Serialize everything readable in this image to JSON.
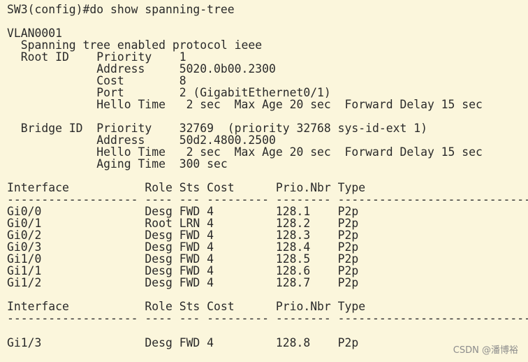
{
  "terminal": {
    "lines": [
      "SW3(config)#do show spanning-tree",
      "",
      "VLAN0001",
      "  Spanning tree enabled protocol ieee",
      "  Root ID    Priority    1",
      "             Address     5020.0b00.2300",
      "             Cost        8",
      "             Port        2 (GigabitEthernet0/1)",
      "             Hello Time   2 sec  Max Age 20 sec  Forward Delay 15 sec",
      "",
      "  Bridge ID  Priority    32769  (priority 32768 sys-id-ext 1)",
      "             Address     50d2.4800.2500",
      "             Hello Time   2 sec  Max Age 20 sec  Forward Delay 15 sec",
      "             Aging Time  300 sec",
      "",
      "Interface           Role Sts Cost      Prio.Nbr Type",
      "------------------- ---- --- --------- -------- --------------------------------",
      "Gi0/0               Desg FWD 4         128.1    P2p",
      "Gi0/1               Root LRN 4         128.2    P2p",
      "Gi0/2               Desg FWD 4         128.3    P2p",
      "Gi0/3               Desg FWD 4         128.4    P2p",
      "Gi1/0               Desg FWD 4         128.5    P2p",
      "Gi1/1               Desg FWD 4         128.6    P2p",
      "Gi1/2               Desg FWD 4         128.7    P2p",
      "",
      "Interface           Role Sts Cost      Prio.Nbr Type",
      "------------------- ---- --- --------- -------- --------------------------------",
      "",
      "Gi1/3               Desg FWD 4         128.8    P2p"
    ]
  },
  "watermark": {
    "text": "CSDN @潘博裕"
  }
}
